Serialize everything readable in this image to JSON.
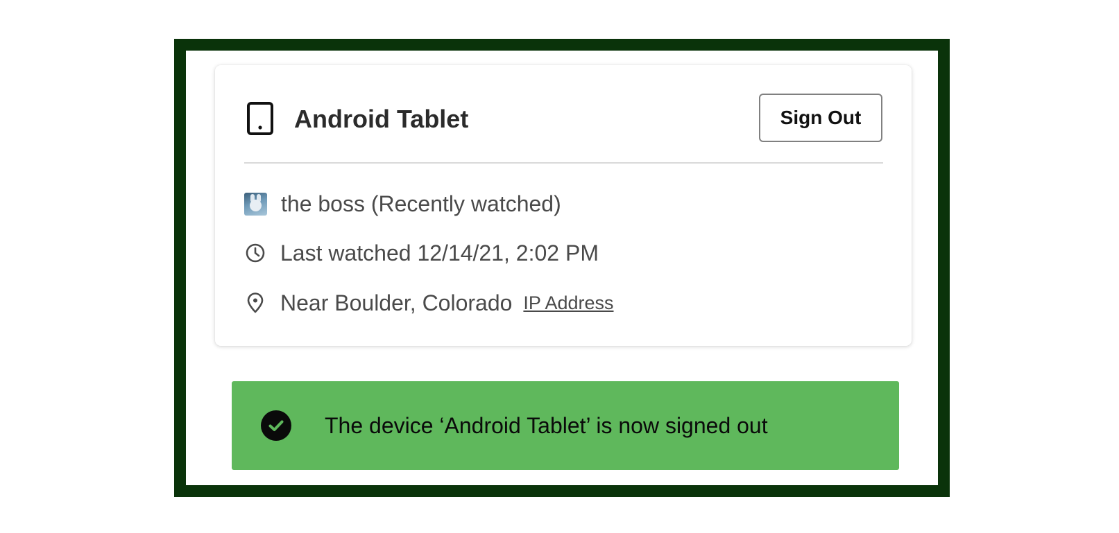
{
  "device": {
    "icon": "tablet-icon",
    "name": "Android Tablet",
    "sign_out_label": "Sign Out"
  },
  "details": {
    "profile": {
      "icon": "profile-avatar",
      "text": "the boss (Recently watched)"
    },
    "last_watched": {
      "icon": "clock-icon",
      "text": "Last watched 12/14/21, 2:02 PM"
    },
    "location": {
      "icon": "location-pin-icon",
      "text": "Near Boulder, Colorado",
      "link_label": "IP Address"
    }
  },
  "notification": {
    "icon": "check-circle-icon",
    "message": "The device ‘Android Tablet’ is now signed out",
    "color": "#5fb85c"
  },
  "colors": {
    "frame": "#0a330a",
    "text": "#4a4a4a",
    "heading": "#2b2b2b"
  }
}
